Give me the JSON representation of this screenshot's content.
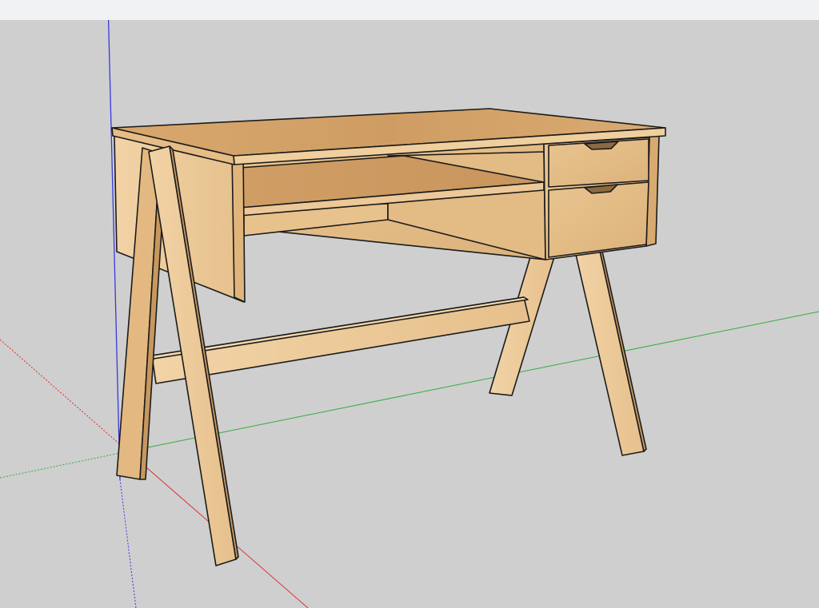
{
  "app": {
    "type": "3d-modeling-viewport",
    "model": "desk"
  },
  "colors": {
    "top_strip": "#f1f2f4",
    "canvas": "#cfcfcf",
    "axis_red": "#e03030",
    "axis_green": "#30b030",
    "axis_blue": "#3030e0",
    "wood_light": "#edc896",
    "wood_mid": "#ddb07a",
    "wood_dark": "#c99a62",
    "wood_top": "#d6a66c",
    "edge": "#1a1a1a"
  },
  "icons": {
    "axes": "model-axes-icon",
    "drawer_pull": "finger-pull-icon"
  }
}
